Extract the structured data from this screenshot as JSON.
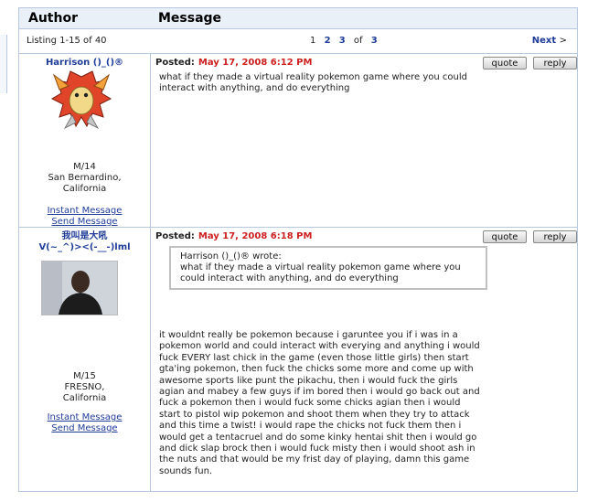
{
  "header": {
    "author_label": "Author",
    "message_label": "Message"
  },
  "listing": {
    "count_text": "Listing 1-15 of 40",
    "pages": [
      "1",
      "2",
      "3"
    ],
    "of_label": "of",
    "total_pages": "3",
    "next_label": "Next",
    "next_arrow": ">"
  },
  "posts": [
    {
      "author": "Harrison ()_()®",
      "avatar_icon": "pokemon-avatar-icon",
      "age_sex": "M/14",
      "location_line1": "San Bernardino,",
      "location_line2": "California",
      "instant_message": "Instant Message",
      "send_message": "Send Message",
      "posted_label": "Posted:",
      "posted_date": "May 17, 2008 6:12 PM",
      "quote_button": "quote",
      "reply_button": "reply",
      "body_lines": [
        "what if they made a virtual reality pokemon game where you could",
        "interact with anything, and do everything"
      ]
    },
    {
      "author_line1": "我叫是大吼",
      "author_line2": "V(~_^)><(-__-)lml",
      "avatar_icon": "user-photo-icon",
      "age_sex": "M/15",
      "location_line1": "FRESNO,",
      "location_line2": "California",
      "instant_message": "Instant Message",
      "send_message": "Send Message",
      "posted_label": "Posted:",
      "posted_date": "May 17, 2008 6:18 PM",
      "quote_button": "quote",
      "reply_button": "reply",
      "quote_author": "Harrison ()_()® wrote:",
      "quote_lines": [
        "what if they made a virtual reality pokemon game where you",
        "could interact with anything, and do everything"
      ],
      "body_lines": [
        "it wouldnt really be pokemon because i garuntee you if i was in a",
        "pokemon world and could interact with everying and anything i would",
        "fuck EVERY last chick in the game (even those little girls) then start",
        "gta'ing pokemon, then fuck the chicks some more and come up with",
        "awesome sports like punt the pikachu, then i would fuck the girls",
        "agian and mabey a few guys if im bored then i would go back out and",
        "fuck a pokemon then i would fuck some chicks agian then i would",
        "start to pistol wip pokemon and shoot them when they try to attack",
        "and this time a twist! i would rape the chicks not fuck them then i",
        "would get a tentacruel and do some kinky hentai shit then i would go",
        "and dick slap brock then i would fuck misty then i would shoot ash in",
        "the nuts and that would be my frist day of playing, damn this game",
        "sounds fun."
      ]
    }
  ]
}
